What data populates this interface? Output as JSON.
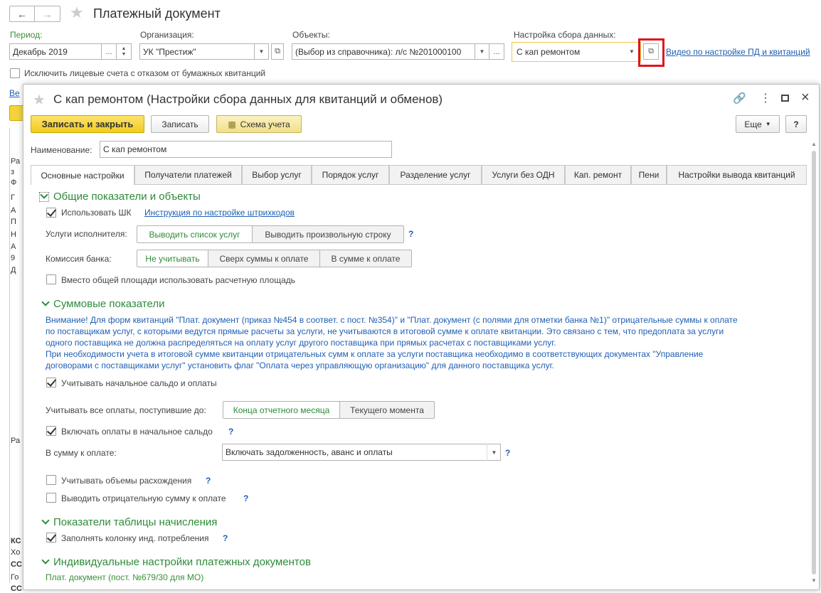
{
  "main": {
    "title": "Платежный документ",
    "period_label": "Период:",
    "period_value": "Декабрь 2019",
    "org_label": "Организация:",
    "org_value": "УК \"Престиж\"",
    "objects_label": "Объекты:",
    "objects_value": "(Выбор из справочника): л/с №201000100",
    "data_setting_label": "Настройка сбора данных:",
    "data_setting_value": "С кап ремонтом",
    "video_link": "Видео по настройке ПД и квитанций",
    "exclude_checkbox": "Исключить лицевые счета с отказом от бумажных квитанций",
    "ellipsis": "...",
    "bg_link": "Ве",
    "bg_left_chars": [
      "Ра",
      "з",
      "Ф",
      "Г",
      "А",
      "П",
      "Н",
      "А",
      "9",
      "Д",
      "Ра"
    ],
    "bg_bottom_rows": [
      "КС",
      "Хо",
      "СС",
      "Го",
      "СС"
    ]
  },
  "dialog": {
    "title": "С кап ремонтом (Настройки сбора данных для квитанций и обменов)",
    "save_close": "Записать и закрыть",
    "save": "Записать",
    "scheme": "Схема учета",
    "more": "Еще",
    "help": "?",
    "name_label": "Наименование:",
    "name_value": "С кап ремонтом",
    "tabs": [
      "Основные настройки",
      "Получатели платежей",
      "Выбор услуг",
      "Порядок услуг",
      "Разделение услуг",
      "Услуги без ОДН",
      "Кап. ремонт",
      "Пени",
      "Настройки вывода квитанций"
    ],
    "sec1_title": "Общие показатели и объекты",
    "use_barcode": "Использовать ШК",
    "barcode_link": "Инструкция по настройке штрихкодов",
    "services_label": "Услуги исполнителя:",
    "services_opts": [
      "Выводить список услуг",
      "Выводить произвольную строку"
    ],
    "commission_label": "Комиссия банка:",
    "commission_opts": [
      "Не учитывать",
      "Сверх суммы к оплате",
      "В сумме к оплате"
    ],
    "use_calc_area": "Вместо общей площади использовать расчетную площадь",
    "sec2_title": "Суммовые показатели",
    "note_lines": [
      "Внимание! Для форм квитанций \"Плат. документ (приказ №454 в соответ. с пост. №354)\" и \"Плат. документ (с полями для отметки банка №1)\" отрицательные суммы к оплате",
      "по поставщикам услуг, с которыми ведутся прямые расчеты за услуги, не учитываются в итоговой сумме к оплате квитанции. Это связано с тем, что предоплата за услуги",
      "одного поставщика не должна распределяться на оплату услуг другого поставщика при прямых расчетах с поставщиками услуг.",
      "При необходимости учета в итоговой сумме квитанции отрицательных сумм к оплате за услуги поставщика необходимо в соответствующих документах \"Управление",
      "договорами с поставщиками услуг\" установить флаг \"Оплата через управляющую организацию\" для данного поставщика услуг."
    ],
    "initial_balance": "Учитывать начальное сальдо и оплаты",
    "payments_label": "Учитывать все оплаты, поступившие до:",
    "payments_opts": [
      "Конца отчетного месяца",
      "Текущего момента"
    ],
    "include_payments": "Включать оплаты в начальное сальдо",
    "sum_label": "В сумму к оплате:",
    "sum_value": "Включать задолженность, аванс и оплаты",
    "volume_diff": "Учитывать объемы расхождения",
    "negative_sum": "Выводить отрицательную сумму к оплате",
    "sec3_title": "Показатели таблицы начисления",
    "fill_column": "Заполнять колонку инд. потребления",
    "sec4_title": "Индивидуальные настройки платежных документов",
    "sec4_item": "Плат. документ (пост. №679/30 для МО)"
  }
}
